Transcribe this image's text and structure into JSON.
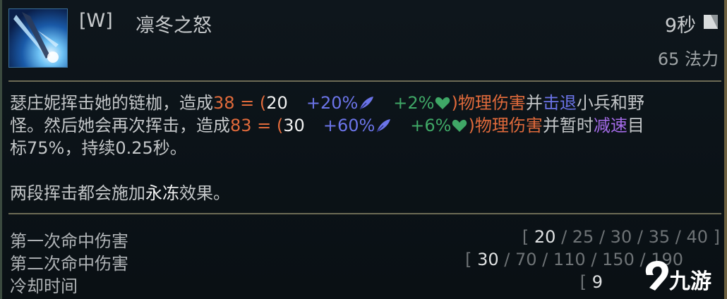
{
  "header": {
    "hotkey": "[W]",
    "ability_name": "凛冬之怒",
    "cooldown": "9秒",
    "cost": "65 法力"
  },
  "description": {
    "l1_a": "瑟庄妮挥击她的链枷，造成",
    "l1_dmg": "38 = (",
    "l1_base": "20",
    "l1_ap": "+20%",
    "l1_hp": "+2%",
    "l1_close": ")",
    "l1_type": "物理伤害",
    "l1_b": "并",
    "l1_kb": "击退",
    "l1_c": "小兵和野",
    "l2_a": "怪。然后她会再次挥击，造成",
    "l2_dmg": "83 = (",
    "l2_base": "30",
    "l2_ap": "+60%",
    "l2_hp": "+6%",
    "l2_close": ")",
    "l2_type": "物理伤害",
    "l2_b": "并暂时",
    "l2_slow": "减速",
    "l2_c": "目",
    "l3": "标75%，持续0.25秒。",
    "l4_a": "两段挥击都会施加",
    "l4_key": "永冻",
    "l4_b": "效果。"
  },
  "stats": [
    {
      "label": "第一次命中伤害",
      "open": "[ ",
      "current": "20",
      "others": [
        "25",
        "30",
        "35",
        "40"
      ],
      "close": " ]"
    },
    {
      "label": "第二次命中伤害",
      "open": "[ ",
      "current": "30",
      "others": [
        "70",
        "110",
        "150",
        "190"
      ],
      "close": ""
    },
    {
      "label": "冷却时间",
      "open": "[ ",
      "current": "9",
      "others": [],
      "close": ""
    }
  ],
  "watermark": {
    "text": "九游",
    "icon": "jiuyou-logo-icon"
  },
  "icons": {
    "ability": "frost-flail-ability-icon",
    "cooldown": "cooldown-icon",
    "ap": "ability-power-feather-icon",
    "hp": "health-heart-icon"
  },
  "colors": {
    "damage": "#e06a3b",
    "ap": "#6b74e8",
    "hp": "#3fa766",
    "slow": "#a46be8",
    "divider": "#6d6b55"
  }
}
